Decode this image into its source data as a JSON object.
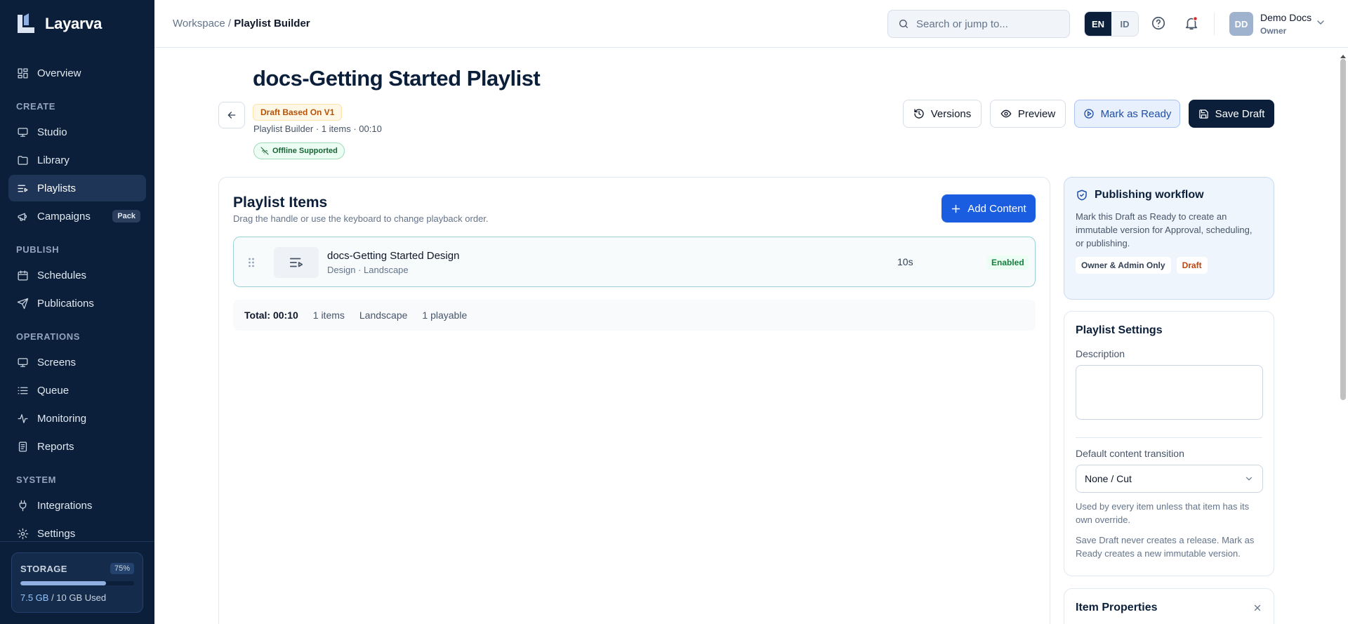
{
  "app": {
    "name": "Layarva"
  },
  "nav": {
    "overview": "Overview",
    "create_section": "CREATE",
    "studio": "Studio",
    "library": "Library",
    "playlists": "Playlists",
    "campaigns": "Campaigns",
    "campaigns_badge": "Pack",
    "publish_section": "PUBLISH",
    "schedules": "Schedules",
    "publications": "Publications",
    "operations_section": "OPERATIONS",
    "screens": "Screens",
    "queue": "Queue",
    "monitoring": "Monitoring",
    "reports": "Reports",
    "system_section": "SYSTEM",
    "integrations": "Integrations",
    "settings": "Settings"
  },
  "storage": {
    "label": "STORAGE",
    "percent_label": "75%",
    "fill_fraction": 0.75,
    "used": "7.5 GB",
    "total_text": " / 10 GB Used"
  },
  "header": {
    "breadcrumb_root": "Workspace / ",
    "breadcrumb_current": "Playlist Builder",
    "search_placeholder": "Search or jump to...",
    "lang_en": "EN",
    "lang_id": "ID",
    "avatar_initials": "DD",
    "user_name": "Demo Docs",
    "user_role": "Owner"
  },
  "page": {
    "title": "docs-Getting Started Playlist",
    "draft_badge": "Draft Based On V1",
    "meta": "Playlist Builder · 1 items · 00:10",
    "offline_badge": "Offline Supported",
    "btn_versions": "Versions",
    "btn_preview": "Preview",
    "btn_ready": "Mark as Ready",
    "btn_save": "Save Draft"
  },
  "items_card": {
    "title": "Playlist Items",
    "subtitle": "Drag the handle or use the keyboard to change playback order.",
    "add_button": "Add Content",
    "items": [
      {
        "name": "docs-Getting Started Design",
        "meta": "Design · Landscape",
        "duration": "10s",
        "status": "Enabled"
      }
    ],
    "totals": {
      "total": "Total: 00:10",
      "count": "1 items",
      "orientation": "Landscape",
      "playable": "1 playable"
    }
  },
  "workflow": {
    "title": "Publishing workflow",
    "text": "Mark this Draft as Ready to create an immutable version for Approval, scheduling, or publishing.",
    "tag_role": "Owner & Admin Only",
    "tag_state": "Draft"
  },
  "settings": {
    "title": "Playlist Settings",
    "description_label": "Description",
    "description_value": "",
    "transition_label": "Default content transition",
    "transition_value": "None / Cut",
    "help_1": "Used by every item unless that item has its own override.",
    "help_2": "Save Draft never creates a release. Mark as Ready creates a new immutable version."
  },
  "properties": {
    "title": "Item Properties"
  }
}
